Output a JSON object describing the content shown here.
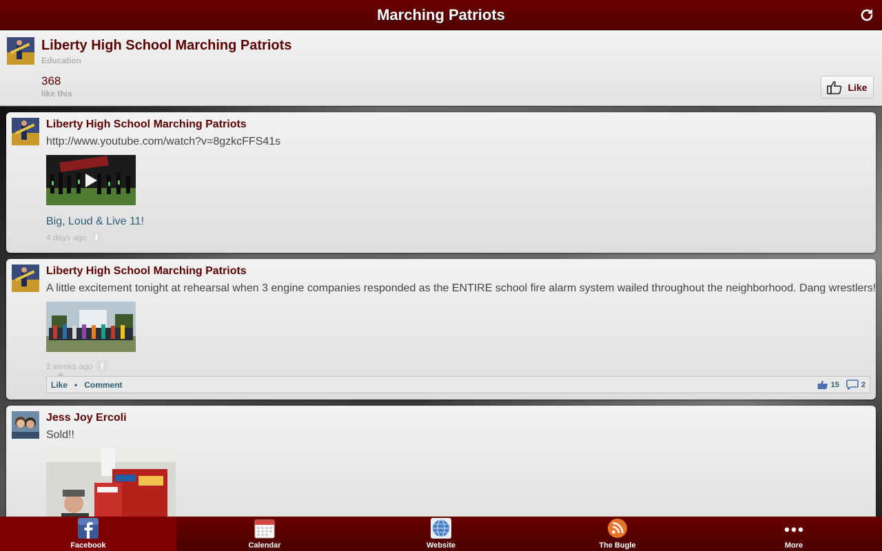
{
  "app": {
    "title": "Marching Patriots"
  },
  "page": {
    "name": "Liberty High School Marching Patriots",
    "category": "Education",
    "like_count": "368",
    "like_text": "like this",
    "like_button": "Like"
  },
  "posts": [
    {
      "author": "Liberty High School Marching Patriots",
      "message": "http://www.youtube.com/watch?v=8gzkcFFS41s",
      "link_title": "Big, Loud & Live 11!",
      "timestamp": "4 days ago"
    },
    {
      "author": "Liberty High School Marching Patriots",
      "message": "A little excitement tonight at rehearsal when 3 engine companies responded as the ENTIRE school fire alarm system wailed throughout the neighborhood. Dang wrestlers!",
      "timestamp": "2 weeks ago",
      "actions": {
        "like": "Like",
        "separator": "•",
        "comment": "Comment"
      },
      "likes": "15",
      "comments": "2"
    },
    {
      "author": "Jess Joy Ercoli",
      "message": "Sold!!"
    }
  ],
  "nav": [
    {
      "label": "Facebook",
      "icon": "facebook-icon"
    },
    {
      "label": "Calendar",
      "icon": "calendar-icon"
    },
    {
      "label": "Website",
      "icon": "globe-icon"
    },
    {
      "label": "The Bugle",
      "icon": "rss-icon"
    },
    {
      "label": "More",
      "icon": "more-icon"
    }
  ],
  "colors": {
    "brand": "#5a0000",
    "link": "#2f5d76"
  }
}
